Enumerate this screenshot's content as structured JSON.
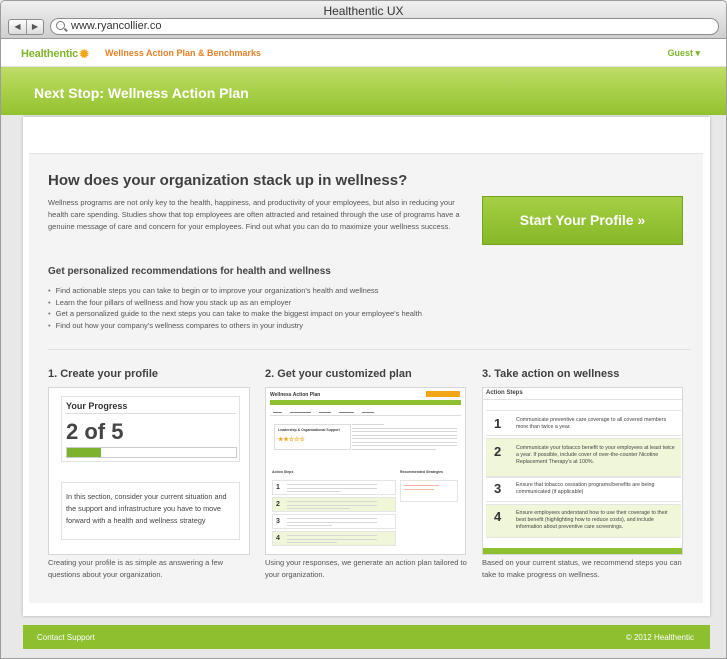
{
  "browser": {
    "window_title": "Healthentic UX",
    "url": "www.ryancollier.co",
    "back_glyph": "◀",
    "forward_glyph": "▶"
  },
  "topnav": {
    "logo_text": "Healthentic",
    "logo_mark": "✹",
    "nav_link": "Wellness Action Plan & Benchmarks",
    "guest_label": "Guest ▾"
  },
  "hero": {
    "title": "Next Stop: Wellness Action Plan"
  },
  "main": {
    "headline": "How does your organization stack up in wellness?",
    "intro": "Wellness programs are not only key to the health, happiness, and productivity of your employees, but also in reducing your health care spending. Studies show that top employees are often attracted and retained through the use of programs have a genuine message of care and concern for your employees. Find out what you can do to maximize your wellness success.",
    "cta_label": "Start Your Profile »",
    "subhead": "Get personalized recommendations for health and wellness",
    "bullets": [
      "Find actionable steps you can take to begin or to improve your organization's health and wellness",
      "Learn the four pillars of wellness and how you stack up as an employer",
      "Get a personalized guide to the next steps you can take to make the biggest impact on your employee's health",
      "Find out how your company's wellness compares to others in your industry"
    ]
  },
  "steps": [
    {
      "title": "1. Create your profile",
      "caption": "Creating your profile is as simple as answering a few questions about your organization."
    },
    {
      "title": "2. Get your customized plan",
      "caption": "Using your responses, we generate an action plan tailored to your organization."
    },
    {
      "title": "3. Take action on wellness",
      "caption": "Based on your current status, we recommend steps you can take to make progress on wellness."
    }
  ],
  "progress_card": {
    "label": "Your Progress",
    "value_text": "2 of 5",
    "progress_fraction": 0.2,
    "note": "In this section, consider your current situation and the support and infrastructure you have to move forward with a health and wellness strategy"
  },
  "plan_preview": {
    "title": "Wellness Action Plan",
    "section_title": "Leadership & Organizational Support",
    "stars": "★★☆☆☆",
    "action_steps_heading": "Action Steps",
    "recommended_heading": "Recommended Strategies",
    "step_numbers": [
      "1",
      "2",
      "3",
      "4"
    ]
  },
  "action_steps": {
    "heading": "Action Steps",
    "items": [
      {
        "num": "1",
        "text": "Communicate preventive care coverage to all covered members more than twice a year."
      },
      {
        "num": "2",
        "text": "Communicate your tobacco benefit to your employees at least twice a year. If possible, include cover of over-the-counter Nicotine Replacement Therapy's at 100%."
      },
      {
        "num": "3",
        "text": "Ensure that tobacco cessation programs/benefits are being communicated (if applicable)"
      },
      {
        "num": "4",
        "text": "Ensure employees understand how to use their coverage to their best benefit (highlighting how to reduce costs), and include information about preventive care screenings."
      }
    ]
  },
  "footer": {
    "contact": "Contact Support",
    "copyright": "© 2012 Healthentic"
  },
  "colors": {
    "brand_green": "#8dbf2f",
    "accent_orange": "#e3822a",
    "highlight_row": "#eff7d8"
  }
}
